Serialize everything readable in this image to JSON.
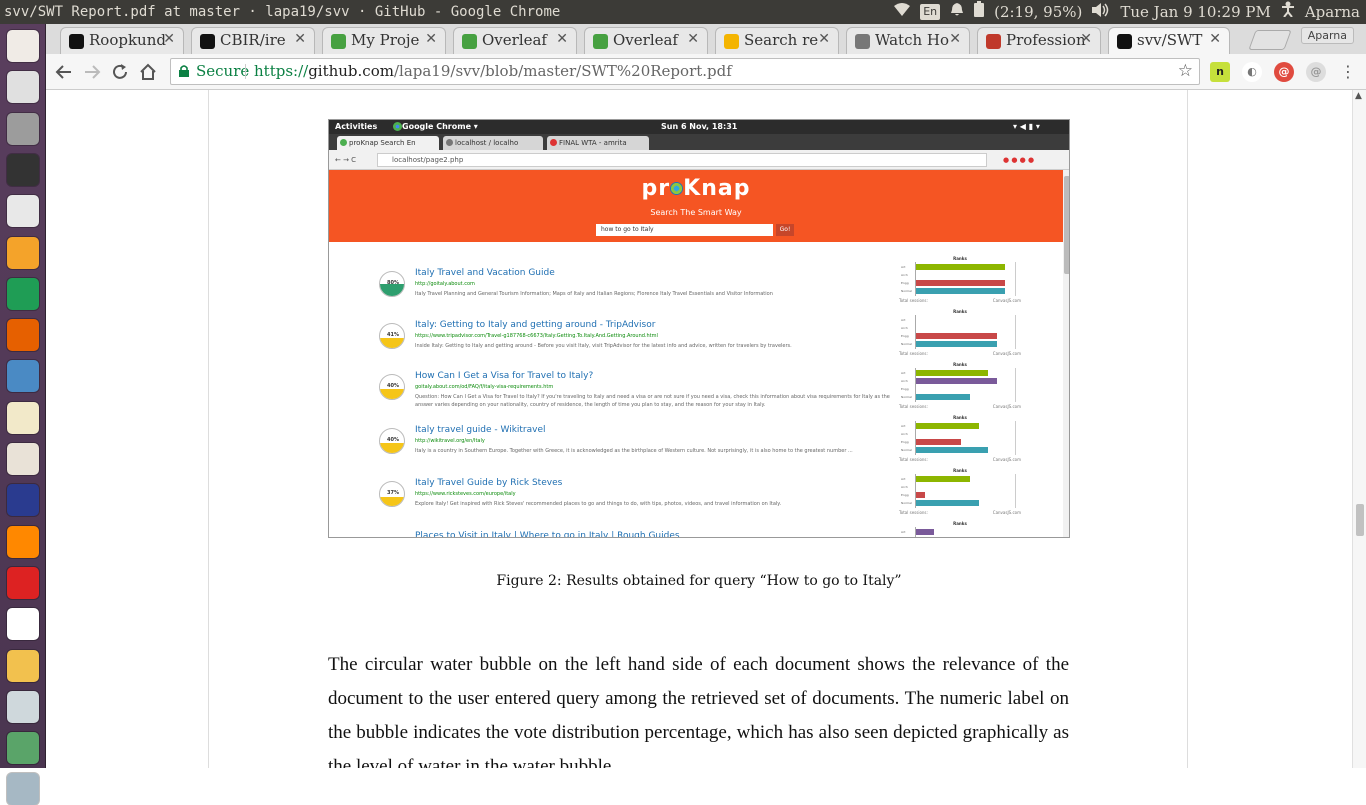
{
  "system_bar": {
    "window_title": "svv/SWT Report.pdf at master · lapa19/svv · GitHub - Google Chrome",
    "keyboard": "En",
    "battery": "(2:19, 95%)",
    "datetime": "Tue Jan  9 10:29 PM",
    "user": "Aparna"
  },
  "launcher": {
    "apps": [
      "ubuntu-dash-icon",
      "chrome-icon",
      "files-icon",
      "terminal-icon",
      "pdf-viewer-icon",
      "sublime-text-icon",
      "spreadsheet-icon",
      "firefox-icon",
      "document-viewer-icon",
      "text-editor-icon",
      "presentation-icon",
      "texmaker-icon",
      "vlc-icon",
      "app-grid-icon",
      "chat-icon",
      "archive-icon",
      "screenshot-icon",
      "system-monitor-icon",
      "workspace-icon"
    ]
  },
  "tabs": [
    {
      "label": "Roopkund",
      "icon": "b-icon",
      "color": "#111111"
    },
    {
      "label": "CBIR/ire",
      "icon": "github-icon",
      "color": "#111111"
    },
    {
      "label": "My Proje",
      "icon": "overleaf-icon",
      "color": "#47a141"
    },
    {
      "label": "Overleaf",
      "icon": "overleaf-icon",
      "color": "#47a141"
    },
    {
      "label": "Overleaf",
      "icon": "overleaf-icon",
      "color": "#47a141"
    },
    {
      "label": "Search re",
      "icon": "drive-icon",
      "color": "#f4b400"
    },
    {
      "label": "Watch Ho",
      "icon": "page-icon",
      "color": "#777777"
    },
    {
      "label": "Profession",
      "icon": "s-icon",
      "color": "#c0392b"
    },
    {
      "label": "svv/SWT",
      "icon": "github-icon",
      "color": "#111111",
      "active": true
    }
  ],
  "profile_label": "Aparna",
  "address": {
    "secure_label": "Secure",
    "scheme": "https://",
    "domain": "github.com",
    "path": "/lapa19/svv/blob/master/SWT%20Report.pdf"
  },
  "embedded": {
    "topbar": {
      "activities": "Activities",
      "app": "Google Chrome ▾",
      "clock": "Sun  6 Nov, 18:31"
    },
    "tabs": [
      "proKnap Search En",
      "localhost / localho",
      "FINAL WTA - amrita"
    ],
    "url": "localhost/page2.php",
    "brand": "pr Knap",
    "tagline": "Search The Smart Way",
    "query": "how to go to Italy",
    "go_label": "Go!",
    "results": [
      {
        "title": "Italy Travel and Vacation Guide",
        "url": "http://goitaly.about.com",
        "snippet": "Italy Travel Planning and General Tourism Information; Maps of Italy and Italian Regions; Florence Italy Travel Essentials and Visitor Information",
        "pct_label": "80%",
        "water": 0.5,
        "water_color": "#2e9e6e"
      },
      {
        "title": "Italy: Getting to Italy and getting around - TripAdvisor",
        "url": "https://www.tripadvisor.com/Travel-g187768-c6673/Italy:Getting.To.Italy.And.Getting.Around.html",
        "snippet": "Inside Italy: Getting to Italy and getting around - Before you visit Italy, visit TripAdvisor for the latest info and advice, written for travelers by travelers.",
        "pct_label": "41%",
        "water": 0.41,
        "water_color": "#f5c518"
      },
      {
        "title": "How Can I Get a Visa for Travel to Italy?",
        "url": "goitaly.about.com/od/FAQ/f/italy-visa-requirements.htm",
        "snippet": "Question: How Can I Get a Visa for Travel to Italy? If you're traveling to Italy and need a visa or are not sure if you need a visa, check this information about visa requirements for Italy as the answer varies depending on your nationality, country of residence, the length of time you plan to stay, and the reason for your stay in Italy.",
        "pct_label": "40%",
        "water": 0.4,
        "water_color": "#f5c518"
      },
      {
        "title": "Italy travel guide - Wikitravel",
        "url": "http://wikitravel.org/en/Italy",
        "snippet": "Italy is a country in Southern Europe. Together with Greece, it is acknowledged as the birthplace of Western culture. Not surprisingly, it is also home to the greatest number ...",
        "pct_label": "40%",
        "water": 0.4,
        "water_color": "#f5c518"
      },
      {
        "title": "Italy Travel Guide by Rick Steves",
        "url": "https://www.ricksteves.com/europe/italy",
        "snippet": "Explore Italy! Get inspired with Rick Steves' recommended places to go and things to do, with tips, photos, videos, and travel information on Italy.",
        "pct_label": "37%",
        "water": 0.37,
        "water_color": "#f5c518"
      },
      {
        "title": "Places to Visit in Italy | Where to go in Italy | Rough Guides",
        "url": "",
        "snippet": "",
        "pct_label": "",
        "water": 0,
        "water_color": "#f5c518"
      }
    ],
    "vote_charts": [
      {
        "title": "Ranks",
        "labels": [
          "Art",
          "Arch",
          "Engg",
          "Normal"
        ],
        "values": [
          0.89,
          0,
          0.89,
          0.89
        ],
        "colors": [
          "#8db600",
          "#7a5a9a",
          "#c84848",
          "#3aa0b0"
        ],
        "footer_left": "Total sessions:",
        "footer_right": "CanvasJS.com"
      },
      {
        "title": "Ranks",
        "labels": [
          "Art",
          "Arch",
          "Engg",
          "Normal"
        ],
        "values": [
          0,
          0,
          0.81,
          0.81
        ],
        "colors": [
          "#8db600",
          "#7a5a9a",
          "#c84848",
          "#3aa0b0"
        ],
        "footer_left": "Total sessions:",
        "footer_right": "CanvasJS.com"
      },
      {
        "title": "Ranks",
        "labels": [
          "Art",
          "Arch",
          "Engg",
          "Normal"
        ],
        "values": [
          0.72,
          0.81,
          0,
          0.54
        ],
        "colors": [
          "#8db600",
          "#7a5a9a",
          "#c84848",
          "#3aa0b0"
        ],
        "footer_left": "Total sessions:",
        "footer_right": "CanvasJS.com"
      },
      {
        "title": "Ranks",
        "labels": [
          "Art",
          "Arch",
          "Engg",
          "Normal"
        ],
        "values": [
          0.63,
          0,
          0.45,
          0.72
        ],
        "colors": [
          "#8db600",
          "#7a5a9a",
          "#c84848",
          "#3aa0b0"
        ],
        "footer_left": "Total sessions:",
        "footer_right": "CanvasJS.com"
      },
      {
        "title": "Ranks",
        "labels": [
          "Art",
          "Arch",
          "Engg",
          "Normal"
        ],
        "values": [
          0.54,
          0,
          0.09,
          0.63
        ],
        "colors": [
          "#8db600",
          "#7a5a9a",
          "#c84848",
          "#3aa0b0"
        ],
        "footer_left": "Total sessions:",
        "footer_right": "CanvasJS.com"
      },
      {
        "title": "Ranks",
        "labels": [
          "Art"
        ],
        "values": [
          0.18
        ],
        "colors": [
          "#7a5a9a"
        ],
        "footer_left": "",
        "footer_right": ""
      }
    ]
  },
  "document": {
    "caption": "Figure 2: Results obtained for query “How to go to Italy”",
    "paragraph": "The circular water bubble on the left hand side of each document shows the relevance of the document to the user entered query among the retrieved set of documents. The numeric label on the bubble indicates the vote distribution percentage, which has also seen depicted graphically as the level of water in the water bubble."
  }
}
